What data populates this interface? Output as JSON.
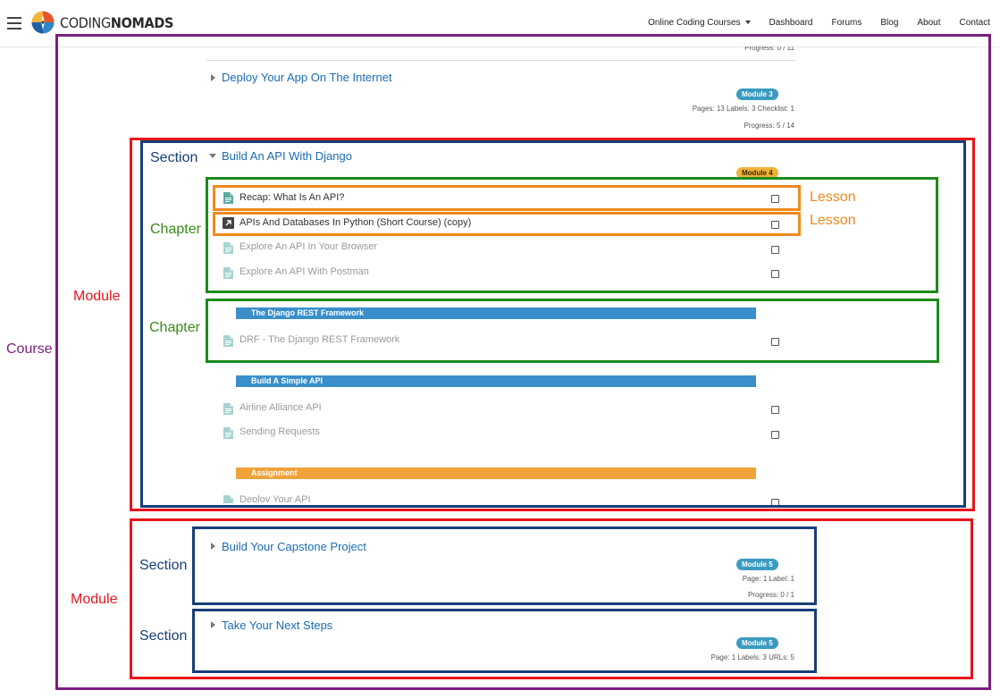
{
  "header": {
    "logo_text_light": "CODING",
    "logo_text_bold": "NOMADS",
    "nav": [
      "Online Coding Courses",
      "Dashboard",
      "Forums",
      "Blog",
      "About",
      "Contact"
    ]
  },
  "annotations": {
    "course": "Course",
    "module": "Module",
    "section": "Section",
    "chapter": "Chapter",
    "lesson": "Lesson"
  },
  "sections": {
    "prev_progress": "Progress: 0 / 11",
    "deploy": {
      "title": "Deploy Your App On The Internet",
      "badge": "Module 3",
      "meta": "Pages: 13  Labels: 3  Checklist: 1",
      "progress": "Progress: 5 / 14"
    },
    "api": {
      "title": "Build An API With Django",
      "badge": "Module 4",
      "lessons": [
        "Recap: What Is An API?",
        "APIs And Databases In Python (Short Course) (copy)",
        "Explore An API In Your Browser",
        "Explore An API With Postman",
        "DRF - The Django REST Framework",
        "Airline Alliance API",
        "Sending Requests",
        "Deploy Your API"
      ],
      "chapters": [
        "The Django REST Framework",
        "Build A Simple API",
        "Assignment"
      ]
    },
    "capstone": {
      "title": "Build Your Capstone Project",
      "badge": "Module 5",
      "meta": "Page: 1  Label: 1",
      "progress": "Progress: 0 / 1"
    },
    "next": {
      "title": "Take Your Next Steps",
      "badge": "Module 5",
      "meta": "Page: 1  Labels: 3  URLs: 5"
    }
  },
  "colors": {
    "course_border": "#7b1f7e",
    "module_border": "#e8141b",
    "section_border": "#173f78",
    "chapter_border": "#1c8a1c",
    "lesson_border": "#f08a1c",
    "link_blue": "#1a6bb5",
    "badge_teal": "#3a9bc1",
    "badge_yellow": "#f0b13a",
    "chapter_bar_blue": "#3a8fcb",
    "chapter_bar_amber": "#f0a23a"
  }
}
